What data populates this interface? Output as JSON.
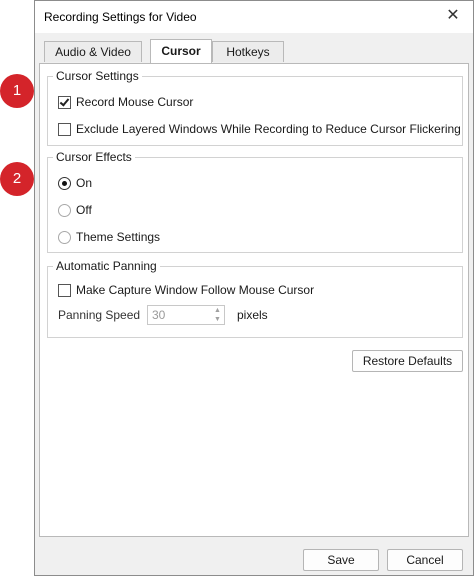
{
  "dialog": {
    "title": "Recording Settings for Video",
    "close_icon": "close-icon"
  },
  "tabs": [
    {
      "label": "Audio & Video",
      "active": false
    },
    {
      "label": "Cursor",
      "active": true
    },
    {
      "label": "Hotkeys",
      "active": false
    }
  ],
  "cursor_settings": {
    "title": "Cursor Settings",
    "record_mouse_cursor": {
      "label": "Record Mouse Cursor",
      "checked": true
    },
    "exclude_layered": {
      "label": "Exclude Layered Windows While Recording to Reduce Cursor Flickering",
      "checked": false
    }
  },
  "cursor_effects": {
    "title": "Cursor Effects",
    "options": [
      {
        "label": "On",
        "selected": true
      },
      {
        "label": "Off",
        "selected": false
      },
      {
        "label": "Theme Settings",
        "selected": false
      }
    ]
  },
  "automatic_panning": {
    "title": "Automatic Panning",
    "follow_cursor": {
      "label": "Make Capture Window Follow Mouse Cursor",
      "checked": false
    },
    "panning_speed_label": "Panning Speed",
    "panning_speed_value": "30",
    "panning_speed_unit": "pixels"
  },
  "buttons": {
    "restore_defaults": "Restore Defaults",
    "save": "Save",
    "cancel": "Cancel"
  },
  "callouts": [
    "1",
    "2"
  ],
  "colors": {
    "callout": "#d4242a",
    "dialog_bg": "#f0f0f0",
    "panel_bg": "#ffffff"
  }
}
